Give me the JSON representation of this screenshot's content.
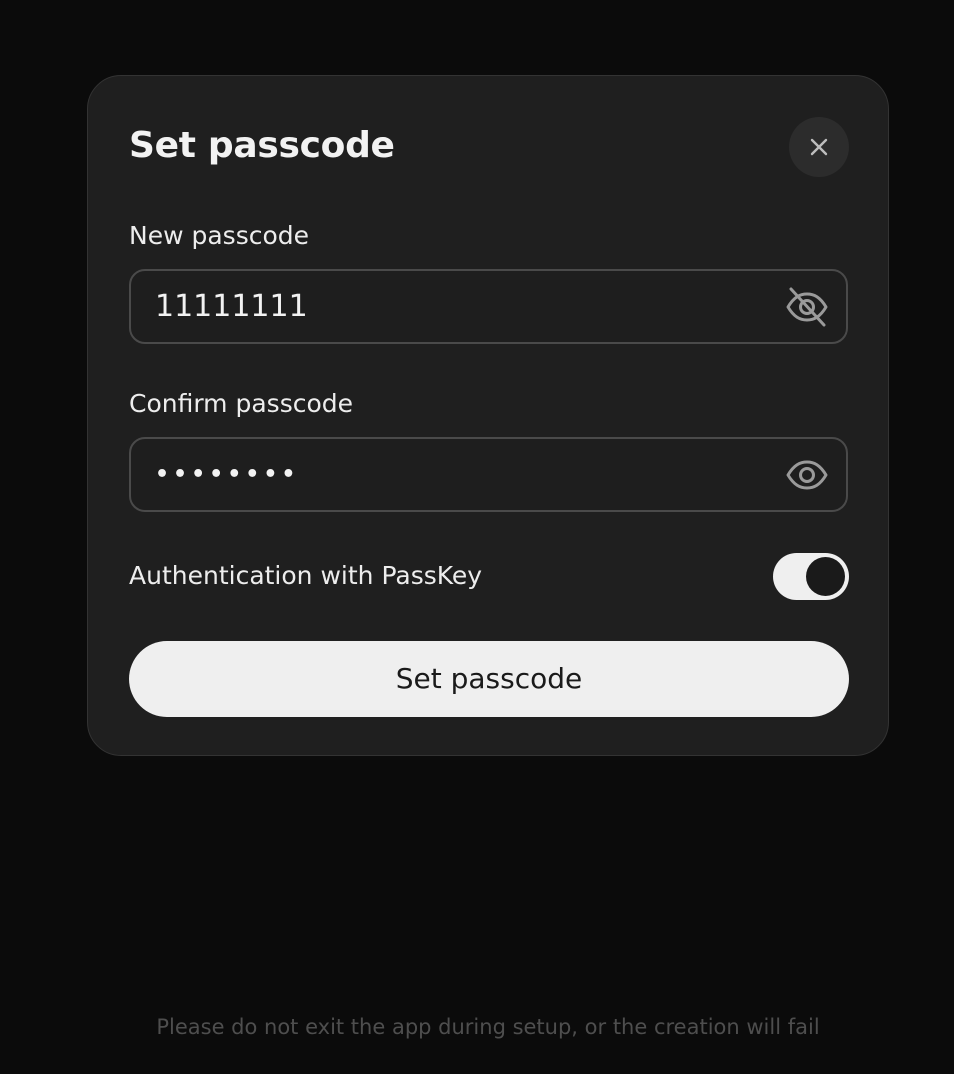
{
  "modal": {
    "title": "Set passcode",
    "close_icon": "close-icon",
    "new_passcode": {
      "label": "New passcode",
      "value": "11111111",
      "visibility_icon": "eye-off-icon"
    },
    "confirm_passcode": {
      "label": "Confirm passcode",
      "masked_value": "••••••••",
      "visibility_icon": "eye-icon"
    },
    "passkey_toggle": {
      "label": "Authentication with PassKey",
      "enabled": true
    },
    "submit_label": "Set passcode"
  },
  "footer": {
    "note": "Please do not exit the app during setup, or the creation will fail"
  },
  "colors": {
    "background": "#0b0b0b",
    "modal": "#1f1f1f",
    "button": "#efefef",
    "text": "#f2f2f2"
  }
}
